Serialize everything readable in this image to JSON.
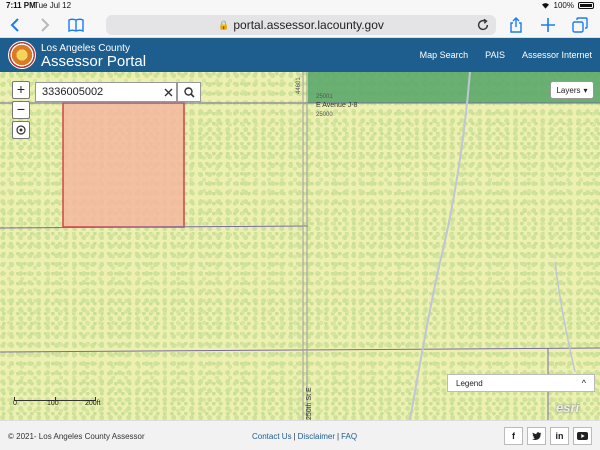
{
  "status_bar": {
    "time": "7:11 PM",
    "date": "Tue Jul 12",
    "battery": "100%"
  },
  "browser": {
    "url": "portal.assessor.lacounty.gov"
  },
  "header": {
    "org_name": "Los Angeles County",
    "title": "Assessor Portal",
    "nav": [
      "Map Search",
      "PAIS",
      "Assessor Internet"
    ]
  },
  "map": {
    "search_value": "3336005002",
    "zoom_in": "+",
    "zoom_out": "−",
    "layers_label": "Layers",
    "labels": {
      "address_top": "25001",
      "address_bottom": "25000",
      "street_avenue": "E Avenue J-8",
      "address_vertical": "44601",
      "street_vertical": "250th St E"
    },
    "legend_label": "Legend",
    "scale": {
      "labels": [
        "0",
        "100",
        "200ft"
      ]
    },
    "attribution": "esri"
  },
  "footer": {
    "copyright": "© 2021- Los Angeles County Assessor",
    "links": [
      "Contact Us",
      "Disclaimer",
      "FAQ"
    ],
    "link_separator": "|",
    "social": [
      "f",
      "t",
      "in",
      "yt"
    ]
  },
  "colors": {
    "header_bg": "#1d5e8e",
    "parcel_fill": "#f5b8a0",
    "parcel_border": "#d0263a",
    "map_bg": "#eef0b2"
  }
}
